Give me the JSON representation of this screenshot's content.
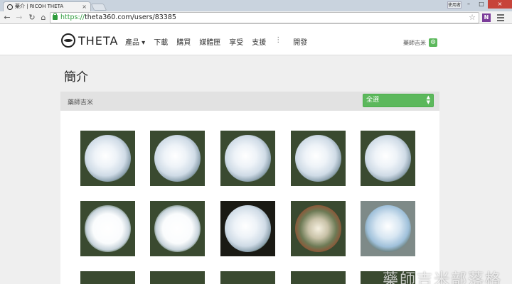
{
  "browser": {
    "tab_title": "藥介 | RICOH THETA",
    "tab_close": "×",
    "url_scheme": "https://",
    "url_rest": "theta360.com/users/83385",
    "user_badge": "使用者"
  },
  "site": {
    "logo_text": "THETA",
    "nav": [
      {
        "label": "產品 ▾"
      },
      {
        "label": "下載"
      },
      {
        "label": "購買"
      },
      {
        "label": "媒體匣"
      },
      {
        "label": "享受"
      },
      {
        "label": "支援"
      }
    ],
    "nav_more": "⋮",
    "nav_develop": "開發",
    "user_name": "藥師吉米"
  },
  "page": {
    "title": "簡介",
    "panel_user": "藥師吉米",
    "filter_value": "全選"
  },
  "thumbnails": [
    {
      "kind": "green"
    },
    {
      "kind": "green"
    },
    {
      "kind": "green"
    },
    {
      "kind": "green"
    },
    {
      "kind": "green"
    },
    {
      "kind": "bright"
    },
    {
      "kind": "bright"
    },
    {
      "kind": "dark"
    },
    {
      "kind": "room"
    },
    {
      "kind": "blue"
    }
  ],
  "watermark": "藥師吉米部落格",
  "icons": {
    "back": "←",
    "forward": "→",
    "reload": "↻",
    "home": "⌂",
    "star": "☆"
  }
}
